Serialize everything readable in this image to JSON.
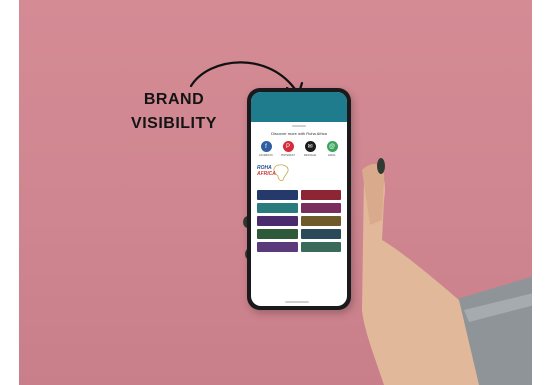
{
  "caption": {
    "line1": "BRAND",
    "line2": "VISIBILITY"
  },
  "colors": {
    "background": "#d48b94",
    "screen_header": "#1f7c8d",
    "share_circles": [
      "#2f5fa0",
      "#d62b3a",
      "#1b1b1b",
      "#3aa45a"
    ],
    "tiles": [
      "#253a6a",
      "#8e2535",
      "#2a7b7e",
      "#7a2e5f",
      "#4c2a6e",
      "#6e5a2a",
      "#2e5a3a",
      "#2a4a5a",
      "#5a3a7a",
      "#3a6a5a"
    ]
  },
  "phone_sheet": {
    "title": "Discover more with Roha Africa",
    "share_targets": [
      {
        "label": "FACEBOOK",
        "icon": "facebook-icon",
        "glyph": "f"
      },
      {
        "label": "PINTEREST",
        "icon": "pinterest-icon",
        "glyph": "P"
      },
      {
        "label": "MESSAGE",
        "icon": "message-icon",
        "glyph": "✉"
      },
      {
        "label": "EMAIL",
        "icon": "email-icon",
        "glyph": "@"
      }
    ],
    "logo_line1": "ROHA",
    "logo_line2": "AFRICA"
  }
}
